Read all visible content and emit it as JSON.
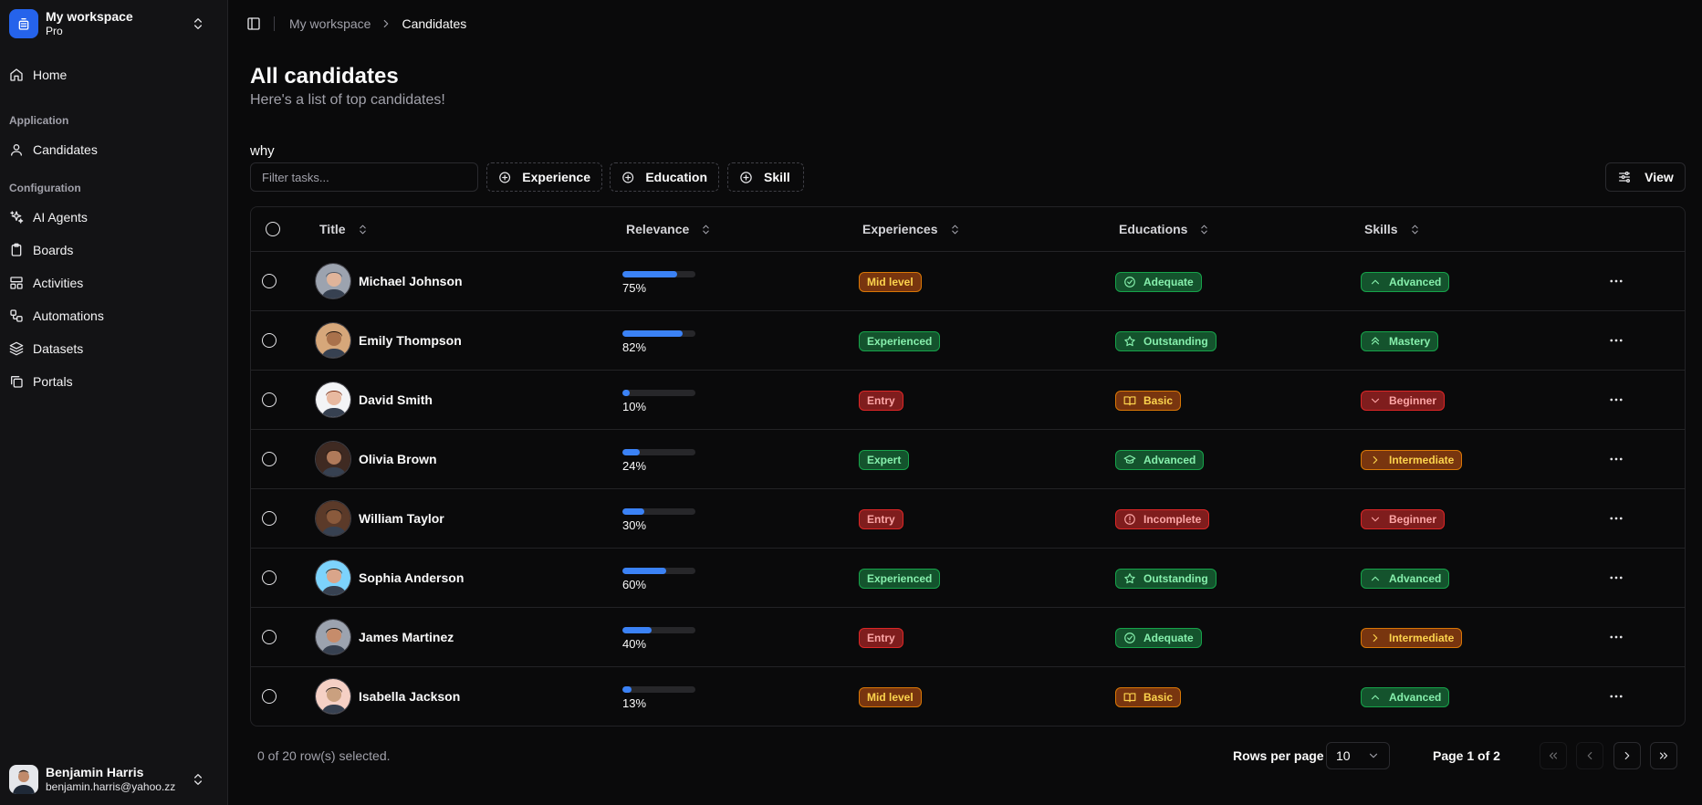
{
  "workspace": {
    "name": "My workspace",
    "plan": "Pro"
  },
  "sidebar": {
    "home": "Home",
    "groups": [
      {
        "label": "Application",
        "items": [
          {
            "label": "Candidates",
            "icon": "user-icon"
          }
        ]
      },
      {
        "label": "Configuration",
        "items": [
          {
            "label": "AI Agents",
            "icon": "sparkles-icon"
          },
          {
            "label": "Boards",
            "icon": "clipboard-icon"
          },
          {
            "label": "Activities",
            "icon": "layout-icon"
          },
          {
            "label": "Automations",
            "icon": "workflow-icon"
          },
          {
            "label": "Datasets",
            "icon": "layers-icon"
          },
          {
            "label": "Portals",
            "icon": "copy-icon"
          }
        ]
      }
    ]
  },
  "user": {
    "name": "Benjamin Harris",
    "email": "benjamin.harris@yahoo.zz"
  },
  "breadcrumb": {
    "root": "My workspace",
    "current": "Candidates"
  },
  "page": {
    "title": "All candidates",
    "subtitle": "Here's a list of top candidates!",
    "note": "why"
  },
  "toolbar": {
    "filter_placeholder": "Filter tasks...",
    "filters": [
      "Experience",
      "Education",
      "Skill"
    ],
    "view_label": "View"
  },
  "table": {
    "columns": [
      "Title",
      "Relevance",
      "Experiences",
      "Educations",
      "Skills"
    ],
    "rows": [
      {
        "name": "Michael Johnson",
        "relevance": 75,
        "relevance_label": "75%",
        "experience": "Mid level",
        "exp_color": "amber",
        "education": "Adequate",
        "edu_icon": "check-circle",
        "edu_color": "green",
        "skill": "Advanced",
        "skill_icon": "chevron-up",
        "skill_color": "green"
      },
      {
        "name": "Emily Thompson",
        "relevance": 82,
        "relevance_label": "82%",
        "experience": "Experienced",
        "exp_color": "green",
        "education": "Outstanding",
        "edu_icon": "star",
        "edu_color": "green",
        "skill": "Mastery",
        "skill_icon": "chevrons-up",
        "skill_color": "green"
      },
      {
        "name": "David Smith",
        "relevance": 10,
        "relevance_label": "10%",
        "experience": "Entry",
        "exp_color": "red",
        "education": "Basic",
        "edu_icon": "book",
        "edu_color": "amber",
        "skill": "Beginner",
        "skill_icon": "chevron-down",
        "skill_color": "red"
      },
      {
        "name": "Olivia Brown",
        "relevance": 24,
        "relevance_label": "24%",
        "experience": "Expert",
        "exp_color": "green",
        "education": "Advanced",
        "edu_icon": "graduation-cap",
        "edu_color": "green",
        "skill": "Intermediate",
        "skill_icon": "chevron-right",
        "skill_color": "amber"
      },
      {
        "name": "William Taylor",
        "relevance": 30,
        "relevance_label": "30%",
        "experience": "Entry",
        "exp_color": "red",
        "education": "Incomplete",
        "edu_icon": "alert-circle",
        "edu_color": "red",
        "skill": "Beginner",
        "skill_icon": "chevron-down",
        "skill_color": "red"
      },
      {
        "name": "Sophia Anderson",
        "relevance": 60,
        "relevance_label": "60%",
        "experience": "Experienced",
        "exp_color": "green",
        "education": "Outstanding",
        "edu_icon": "star",
        "edu_color": "green",
        "skill": "Advanced",
        "skill_icon": "chevron-up",
        "skill_color": "green"
      },
      {
        "name": "James Martinez",
        "relevance": 40,
        "relevance_label": "40%",
        "experience": "Entry",
        "exp_color": "red",
        "education": "Adequate",
        "edu_icon": "check-circle",
        "edu_color": "green",
        "skill": "Intermediate",
        "skill_icon": "chevron-right",
        "skill_color": "amber"
      },
      {
        "name": "Isabella Jackson",
        "relevance": 13,
        "relevance_label": "13%",
        "experience": "Mid level",
        "exp_color": "amber",
        "education": "Basic",
        "edu_icon": "book",
        "edu_color": "amber",
        "skill": "Advanced",
        "skill_icon": "chevron-up",
        "skill_color": "green"
      }
    ]
  },
  "footer": {
    "selected": "0 of 20 row(s) selected.",
    "rows_per_page_label": "Rows per page",
    "rows_per_page": "10",
    "page_info": "Page 1 of 2"
  },
  "colors": {
    "accent": "#2563eb",
    "bar": "#3b82f6",
    "background": "#0a0a0b",
    "sidebar": "#131315"
  }
}
